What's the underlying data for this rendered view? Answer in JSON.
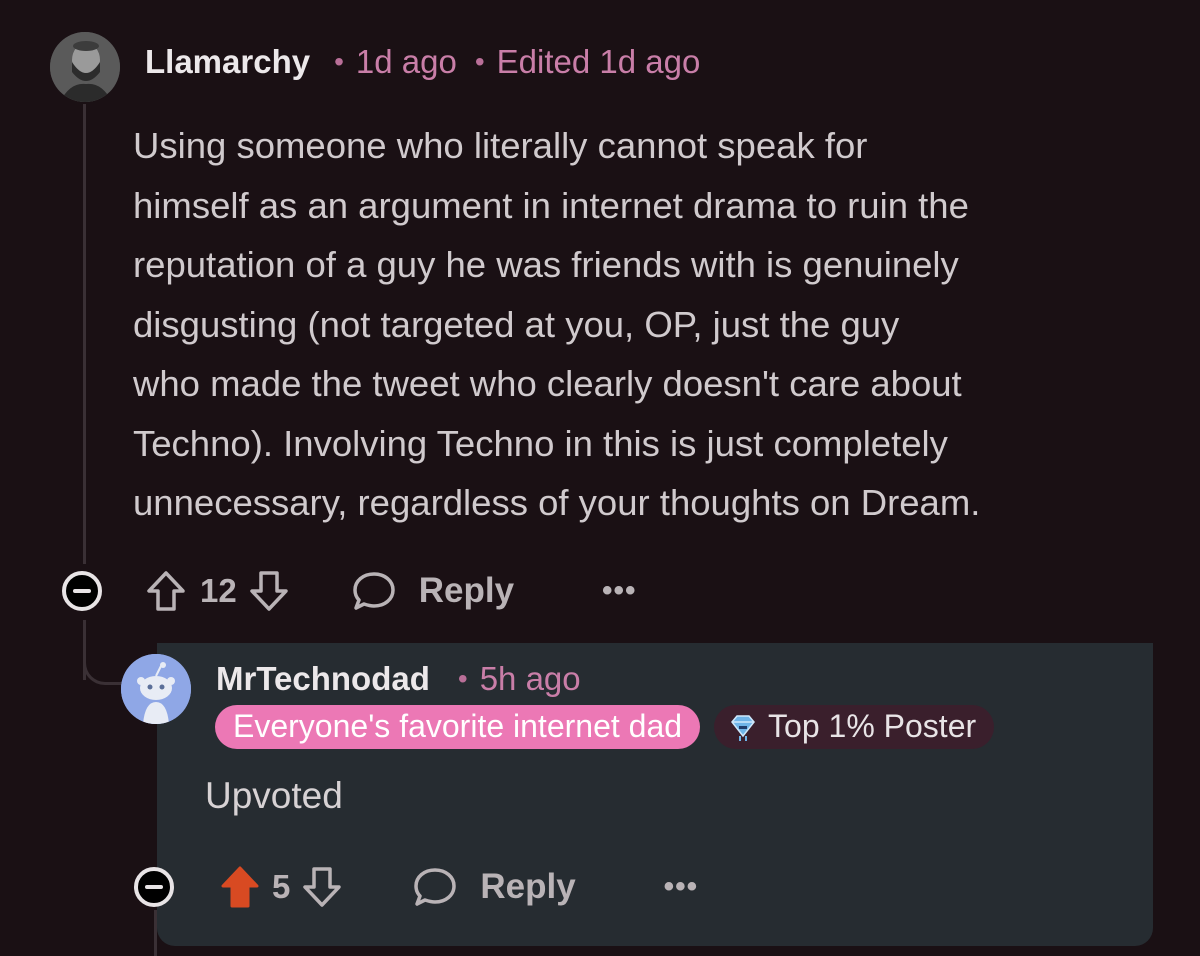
{
  "comment": {
    "username": "Llamarchy",
    "time": "1d ago",
    "edited": "Edited 1d ago",
    "separator": "•",
    "body": "Using someone who literally cannot speak for\nhimself as an argument in internet drama to ruin the\nreputation of a guy he was friends with is genuinely\ndisgusting (not targeted at you, OP, just the guy\nwho made the tweet who clearly doesn't care about\nTechno). Involving Techno in this is just completely\nunnecessary, regardless of your thoughts on Dream.",
    "votes": "12",
    "reply_label": "Reply",
    "more_label": "•••"
  },
  "reply": {
    "username": "MrTechnodad",
    "time": "5h ago",
    "separator": "•",
    "flair_text": "Everyone's favorite internet dad",
    "badge_text": "Top 1% Poster",
    "badge_icon": "diamond-poster-icon",
    "body": "Upvoted",
    "votes": "5",
    "upvoted": true,
    "reply_label": "Reply",
    "more_label": "•••"
  },
  "colors": {
    "background": "#1a1014",
    "reply_background": "#262c31",
    "meta_pink": "#c97ea8",
    "flair_pink": "#ec78b5",
    "upvote_active": "#d84a22"
  }
}
